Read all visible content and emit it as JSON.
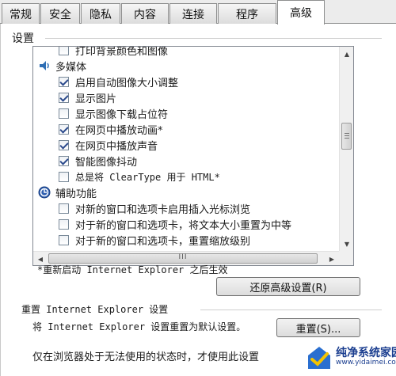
{
  "tabs": [
    {
      "label": "常规"
    },
    {
      "label": "安全"
    },
    {
      "label": "隐私"
    },
    {
      "label": "内容"
    },
    {
      "label": "连接"
    },
    {
      "label": "程序"
    },
    {
      "label": "高级"
    }
  ],
  "active_tab": "高级",
  "settings": {
    "group_title": "设置",
    "rows": [
      {
        "type": "item",
        "label": "打印背景颜色和图像",
        "checked": false
      },
      {
        "type": "category",
        "label": "多媒体",
        "icon": "multimedia-icon"
      },
      {
        "type": "item",
        "label": "启用自动图像大小调整",
        "checked": true
      },
      {
        "type": "item",
        "label": "显示图片",
        "checked": true
      },
      {
        "type": "item",
        "label": "显示图像下载占位符",
        "checked": false
      },
      {
        "type": "item",
        "label": "在网页中播放动画*",
        "checked": true
      },
      {
        "type": "item",
        "label": "在网页中播放声音",
        "checked": true
      },
      {
        "type": "item",
        "label": "智能图像抖动",
        "checked": true
      },
      {
        "type": "item",
        "label": "总是将 ClearType 用于 HTML*",
        "checked": false
      },
      {
        "type": "category",
        "label": "辅助功能",
        "icon": "accessibility-icon"
      },
      {
        "type": "item",
        "label": "对新的窗口和选项卡启用插入光标浏览",
        "checked": false
      },
      {
        "type": "item",
        "label": "对于新的窗口和选项卡，将文本大小重置为中等",
        "checked": false
      },
      {
        "type": "item",
        "label": "对于新的窗口和选项卡，重置缩放级别",
        "checked": false
      }
    ],
    "hscroll_mark": "III"
  },
  "restart_note": "*重新启动 Internet Explorer 之后生效",
  "restore_button": "还原高级设置(R)",
  "reset_section": {
    "title": "重置 Internet Explorer 设置",
    "description": "将 Internet Explorer 设置重置为默认设置。",
    "reset_button": "重置(S)...",
    "footer": "仅在浏览器处于无法使用的状态时，才使用此设置"
  },
  "watermark": {
    "line1": "纯净系统家园",
    "line2": "www.yidaimei.com"
  }
}
